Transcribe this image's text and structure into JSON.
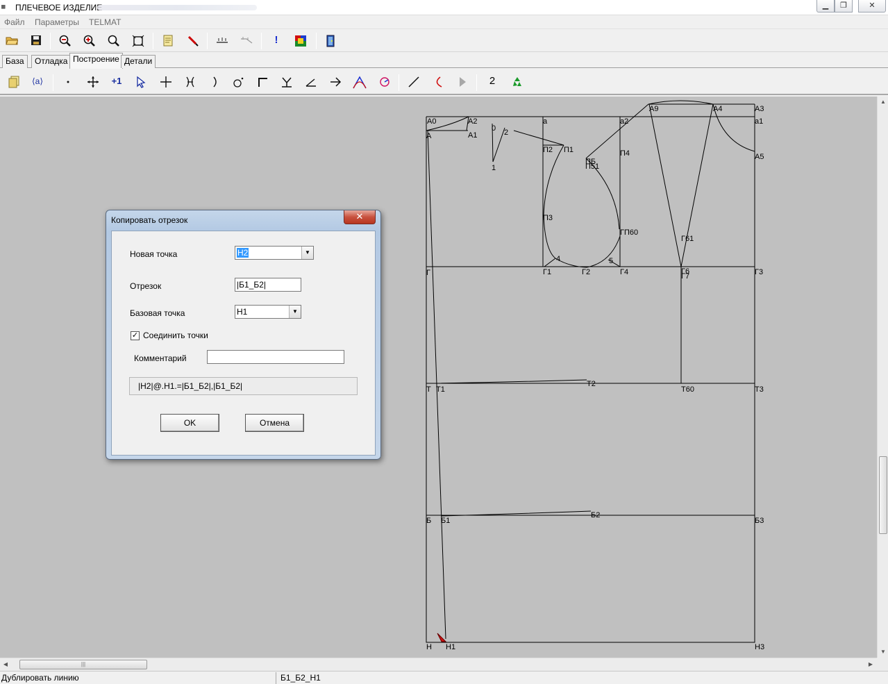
{
  "window": {
    "title": "ПЛЕЧЕВОЕ ИЗДЕЛИЕ",
    "icon": "ruler-app-icon"
  },
  "menu": [
    "Файл",
    "Параметры",
    "TELMAT"
  ],
  "tabs": [
    "База",
    "Отладка",
    "Построение",
    "Детали"
  ],
  "active_tab": "Построение",
  "toolbar2": {
    "counter_label": "2"
  },
  "drawing_labels": {
    "A0": "А0",
    "A2": "А2",
    "A1": "А1",
    "A": "А",
    "d0": "0",
    "d2": "2",
    "d1": "1",
    "a": "а",
    "P2": "П2",
    "P1": "П1",
    "a2": "а2",
    "P4": "П4",
    "PB": "ПБ",
    "P51": "П51",
    "A9": "А9",
    "A4": "А4",
    "A3": "А3",
    "a1": "а1",
    "A5": "А5",
    "P3": "П3",
    "GP60": "ГП60",
    "G61": "Г61",
    "d4": "4",
    "d5": "5",
    "G": "Г",
    "G1": "Г1",
    "G2": "Г2",
    "G4": "Г4",
    "G6": "Г6",
    "G7": "Г7",
    "G3": "Г3",
    "T": "Т",
    "T1": "Т1",
    "T2": "Т2",
    "T60": "Т60",
    "T3": "Т3",
    "B": "Б",
    "B1": "Б1",
    "B2": "Б2",
    "B3": "Б3",
    "H": "Н",
    "H1": "Н1",
    "H3": "Н3"
  },
  "dialog": {
    "title": "Копировать отрезок",
    "new_point_label": "Новая точка",
    "new_point_value": "Н2",
    "segment_label": "Отрезок",
    "segment_value": "|Б1_Б2|",
    "base_point_label": "Базовая точка",
    "base_point_value": "Н1",
    "connect_label": "Соединить точки",
    "connect_checked": true,
    "comment_label": "Комментарий",
    "comment_value": "",
    "formula": "|Н2|@.Н1.=|Б1_Б2|,|Б1_Б2|",
    "ok_label": "OK",
    "cancel_label": "Отмена"
  },
  "status": {
    "left": "Дублировать линию",
    "right": "Б1_Б2_Н1"
  }
}
